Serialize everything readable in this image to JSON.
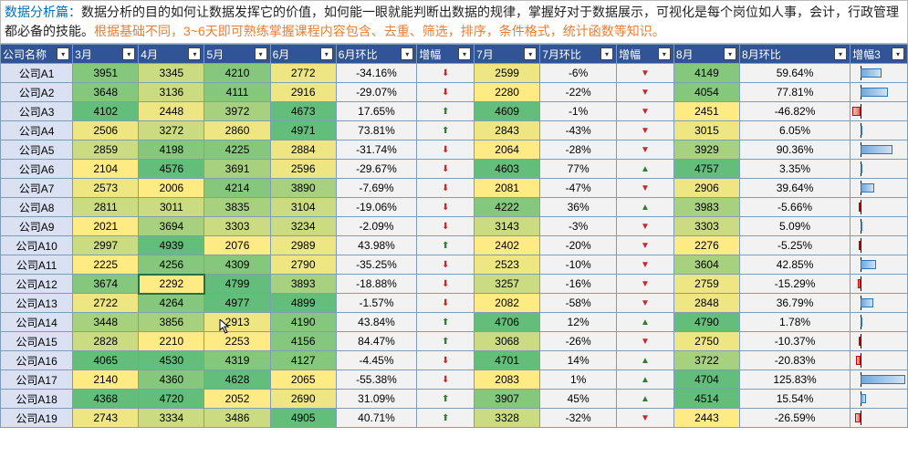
{
  "intro": {
    "part1_blue": "数据分析篇：",
    "part2": "数据分析的目的如何让数据发挥它的价值，如何能一眼就能判断出数据的规律，掌握好对于数据展示，可视化是每个岗位如人事，会计，行政管理都必备的技能。",
    "part3_orange": "根据基础不同，3~6天即可熟练掌握课程内容包含、去重、筛选，排序，条件格式，统计函数等知识。"
  },
  "headers": [
    "公司名称",
    "3月",
    "4月",
    "5月",
    "6月",
    "6月环比",
    "增幅",
    "7月",
    "7月环比",
    "增幅",
    "8月",
    "8月环比",
    "增幅3"
  ],
  "rows": [
    {
      "c": "公司A1",
      "m3": 3951,
      "m4": 3345,
      "m5": 4210,
      "m6": 2772,
      "p6": "-34.16%",
      "a6": "dn",
      "m7": 2599,
      "p7": "-6%",
      "t7": "dn",
      "m8": 4149,
      "p8": "59.64%",
      "b8": 0.6
    },
    {
      "c": "公司A2",
      "m3": 3648,
      "m4": 3136,
      "m5": 4111,
      "m6": 2916,
      "p6": "-29.07%",
      "a6": "dn",
      "m7": 2280,
      "p7": "-22%",
      "t7": "dn",
      "m8": 4054,
      "p8": "77.81%",
      "b8": 0.78
    },
    {
      "c": "公司A3",
      "m3": 4102,
      "m4": 2448,
      "m5": 3972,
      "m6": 4673,
      "p6": "17.65%",
      "a6": "up",
      "m7": 4609,
      "p7": "-1%",
      "t7": "dn",
      "m8": 2451,
      "p8": "-46.82%",
      "b8": -0.47
    },
    {
      "c": "公司A4",
      "m3": 2506,
      "m4": 3272,
      "m5": 2860,
      "m6": 4971,
      "p6": "73.81%",
      "a6": "up",
      "m7": 2843,
      "p7": "-43%",
      "t7": "dn",
      "m8": 3015,
      "p8": "6.05%",
      "b8": 0.06
    },
    {
      "c": "公司A5",
      "m3": 2859,
      "m4": 4198,
      "m5": 4225,
      "m6": 2884,
      "p6": "-31.74%",
      "a6": "dn",
      "m7": 2064,
      "p7": "-28%",
      "t7": "dn",
      "m8": 3929,
      "p8": "90.36%",
      "b8": 0.9
    },
    {
      "c": "公司A6",
      "m3": 2104,
      "m4": 4576,
      "m5": 3691,
      "m6": 2596,
      "p6": "-29.67%",
      "a6": "dn",
      "m7": 4603,
      "p7": "77%",
      "t7": "up",
      "m8": 4757,
      "p8": "3.35%",
      "b8": 0.03
    },
    {
      "c": "公司A7",
      "m3": 2573,
      "m4": 2006,
      "m5": 4214,
      "m6": 3890,
      "p6": "-7.69%",
      "a6": "dn",
      "m7": 2081,
      "p7": "-47%",
      "t7": "dn",
      "m8": 2906,
      "p8": "39.64%",
      "b8": 0.4
    },
    {
      "c": "公司A8",
      "m3": 2811,
      "m4": 3011,
      "m5": 3835,
      "m6": 3104,
      "p6": "-19.06%",
      "a6": "dn",
      "m7": 4222,
      "p7": "36%",
      "t7": "up",
      "m8": 3983,
      "p8": "-5.66%",
      "b8": -0.06
    },
    {
      "c": "公司A9",
      "m3": 2021,
      "m4": 3694,
      "m5": 3303,
      "m6": 3234,
      "p6": "-2.09%",
      "a6": "dn",
      "m7": 3143,
      "p7": "-3%",
      "t7": "dn",
      "m8": 3303,
      "p8": "5.09%",
      "b8": 0.05
    },
    {
      "c": "公司A10",
      "m3": 2997,
      "m4": 4939,
      "m5": 2076,
      "m6": 2989,
      "p6": "43.98%",
      "a6": "up",
      "m7": 2402,
      "p7": "-20%",
      "t7": "dn",
      "m8": 2276,
      "p8": "-5.25%",
      "b8": -0.05
    },
    {
      "c": "公司A11",
      "m3": 2225,
      "m4": 4256,
      "m5": 4309,
      "m6": 2790,
      "p6": "-35.25%",
      "a6": "dn",
      "m7": 2523,
      "p7": "-10%",
      "t7": "dn",
      "m8": 3604,
      "p8": "42.85%",
      "b8": 0.43
    },
    {
      "c": "公司A12",
      "m3": 3674,
      "m4": 2292,
      "m5": 4799,
      "m6": 3893,
      "p6": "-18.88%",
      "a6": "dn",
      "m7": 3257,
      "p7": "-16%",
      "t7": "dn",
      "m8": 2759,
      "p8": "-15.29%",
      "b8": -0.15
    },
    {
      "c": "公司A13",
      "m3": 2722,
      "m4": 4264,
      "m5": 4977,
      "m6": 4899,
      "p6": "-1.57%",
      "a6": "dn",
      "m7": 2082,
      "p7": "-58%",
      "t7": "dn",
      "m8": 2848,
      "p8": "36.79%",
      "b8": 0.37
    },
    {
      "c": "公司A14",
      "m3": 3448,
      "m4": 3856,
      "m5": 2913,
      "m6": 4190,
      "p6": "43.84%",
      "a6": "up",
      "m7": 4706,
      "p7": "12%",
      "t7": "up",
      "m8": 4790,
      "p8": "1.78%",
      "b8": 0.02
    },
    {
      "c": "公司A15",
      "m3": 2828,
      "m4": 2210,
      "m5": 2253,
      "m6": 4156,
      "p6": "84.47%",
      "a6": "up",
      "m7": 3068,
      "p7": "-26%",
      "t7": "dn",
      "m8": 2750,
      "p8": "-10.37%",
      "b8": -0.1
    },
    {
      "c": "公司A16",
      "m3": 4065,
      "m4": 4530,
      "m5": 4319,
      "m6": 4127,
      "p6": "-4.45%",
      "a6": "dn",
      "m7": 4701,
      "p7": "14%",
      "t7": "up",
      "m8": 3722,
      "p8": "-20.83%",
      "b8": -0.21
    },
    {
      "c": "公司A17",
      "m3": 2140,
      "m4": 4360,
      "m5": 4628,
      "m6": 2065,
      "p6": "-55.38%",
      "a6": "dn",
      "m7": 2083,
      "p7": "1%",
      "t7": "up",
      "m8": 4704,
      "p8": "125.83%",
      "b8": 1.26
    },
    {
      "c": "公司A18",
      "m3": 4368,
      "m4": 4720,
      "m5": 2052,
      "m6": 2690,
      "p6": "31.09%",
      "a6": "up",
      "m7": 3907,
      "p7": "45%",
      "t7": "up",
      "m8": 4514,
      "p8": "15.54%",
      "b8": 0.16
    },
    {
      "c": "公司A19",
      "m3": 2743,
      "m4": 3334,
      "m5": 3486,
      "m6": 4905,
      "p6": "40.71%",
      "a6": "up",
      "m7": 3328,
      "p7": "-32%",
      "t7": "dn",
      "m8": 2443,
      "p8": "-26.59%",
      "b8": -0.27
    }
  ],
  "selectedCell": {
    "row": 11,
    "col": "m4"
  },
  "chart_data": {
    "type": "table",
    "title": "各公司3-8月数据及环比增幅",
    "columns": [
      "公司名称",
      "3月",
      "4月",
      "5月",
      "6月",
      "6月环比",
      "7月",
      "7月环比",
      "8月",
      "8月环比"
    ],
    "series": [
      {
        "name": "公司A1",
        "values": [
          3951,
          3345,
          4210,
          2772,
          -34.16,
          2599,
          -6,
          4149,
          59.64
        ]
      },
      {
        "name": "公司A2",
        "values": [
          3648,
          3136,
          4111,
          2916,
          -29.07,
          2280,
          -22,
          4054,
          77.81
        ]
      },
      {
        "name": "公司A3",
        "values": [
          4102,
          2448,
          3972,
          4673,
          17.65,
          4609,
          -1,
          2451,
          -46.82
        ]
      },
      {
        "name": "公司A4",
        "values": [
          2506,
          3272,
          2860,
          4971,
          73.81,
          2843,
          -43,
          3015,
          6.05
        ]
      },
      {
        "name": "公司A5",
        "values": [
          2859,
          4198,
          4225,
          2884,
          -31.74,
          2064,
          -28,
          3929,
          90.36
        ]
      },
      {
        "name": "公司A6",
        "values": [
          2104,
          4576,
          3691,
          2596,
          -29.67,
          4603,
          77,
          4757,
          3.35
        ]
      },
      {
        "name": "公司A7",
        "values": [
          2573,
          2006,
          4214,
          3890,
          -7.69,
          2081,
          -47,
          2906,
          39.64
        ]
      },
      {
        "name": "公司A8",
        "values": [
          2811,
          3011,
          3835,
          3104,
          -19.06,
          4222,
          36,
          3983,
          -5.66
        ]
      },
      {
        "name": "公司A9",
        "values": [
          2021,
          3694,
          3303,
          3234,
          -2.09,
          3143,
          -3,
          3303,
          5.09
        ]
      },
      {
        "name": "公司A10",
        "values": [
          2997,
          4939,
          2076,
          2989,
          43.98,
          2402,
          -20,
          2276,
          -5.25
        ]
      },
      {
        "name": "公司A11",
        "values": [
          2225,
          4256,
          4309,
          2790,
          -35.25,
          2523,
          -10,
          3604,
          42.85
        ]
      },
      {
        "name": "公司A12",
        "values": [
          3674,
          2292,
          4799,
          3893,
          -18.88,
          3257,
          -16,
          2759,
          -15.29
        ]
      },
      {
        "name": "公司A13",
        "values": [
          2722,
          4264,
          4977,
          4899,
          -1.57,
          2082,
          -58,
          2848,
          36.79
        ]
      },
      {
        "name": "公司A14",
        "values": [
          3448,
          3856,
          2913,
          4190,
          43.84,
          4706,
          12,
          4790,
          1.78
        ]
      },
      {
        "name": "公司A15",
        "values": [
          2828,
          2210,
          2253,
          4156,
          84.47,
          3068,
          -26,
          2750,
          -10.37
        ]
      },
      {
        "name": "公司A16",
        "values": [
          4065,
          4530,
          4319,
          4127,
          -4.45,
          4701,
          14,
          3722,
          -20.83
        ]
      },
      {
        "name": "公司A17",
        "values": [
          2140,
          4360,
          4628,
          2065,
          -55.38,
          2083,
          1,
          4704,
          125.83
        ]
      },
      {
        "name": "公司A18",
        "values": [
          4368,
          4720,
          2052,
          2690,
          31.09,
          3907,
          45,
          4514,
          15.54
        ]
      },
      {
        "name": "公司A19",
        "values": [
          2743,
          3334,
          3486,
          4905,
          40.71,
          3328,
          -32,
          2443,
          -26.59
        ]
      }
    ]
  }
}
